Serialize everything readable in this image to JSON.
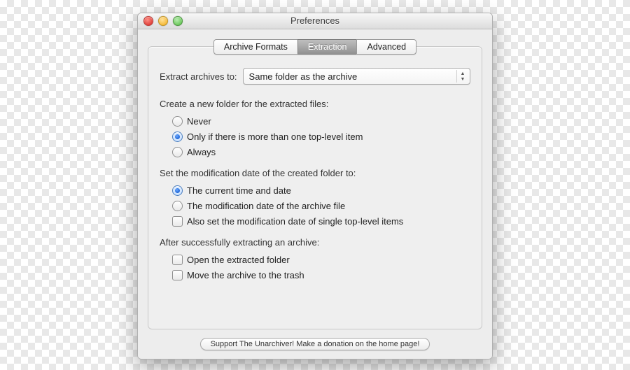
{
  "window": {
    "title": "Preferences"
  },
  "tabs": {
    "archive_formats": "Archive Formats",
    "extraction": "Extraction",
    "advanced": "Advanced",
    "selected": "extraction"
  },
  "extract_to": {
    "label": "Extract archives to:",
    "value": "Same folder as the archive"
  },
  "create_folder": {
    "label": "Create a new folder for the extracted files:",
    "options": {
      "never": "Never",
      "only_multi": "Only if there is more than one top-level item",
      "always": "Always"
    },
    "selected": "only_multi"
  },
  "mod_date": {
    "label": "Set the modification date of the created folder to:",
    "options": {
      "current": "The current time and date",
      "archive": "The modification date of the archive file"
    },
    "selected": "current",
    "also_single": {
      "label": "Also set the modification date of single top-level items",
      "checked": false
    }
  },
  "after_extract": {
    "label": "After successfully extracting an archive:",
    "open_folder": {
      "label": "Open the extracted folder",
      "checked": false
    },
    "move_trash": {
      "label": "Move the archive to the trash",
      "checked": false
    }
  },
  "footer": {
    "donate": "Support The Unarchiver! Make a donation on the home page!"
  }
}
